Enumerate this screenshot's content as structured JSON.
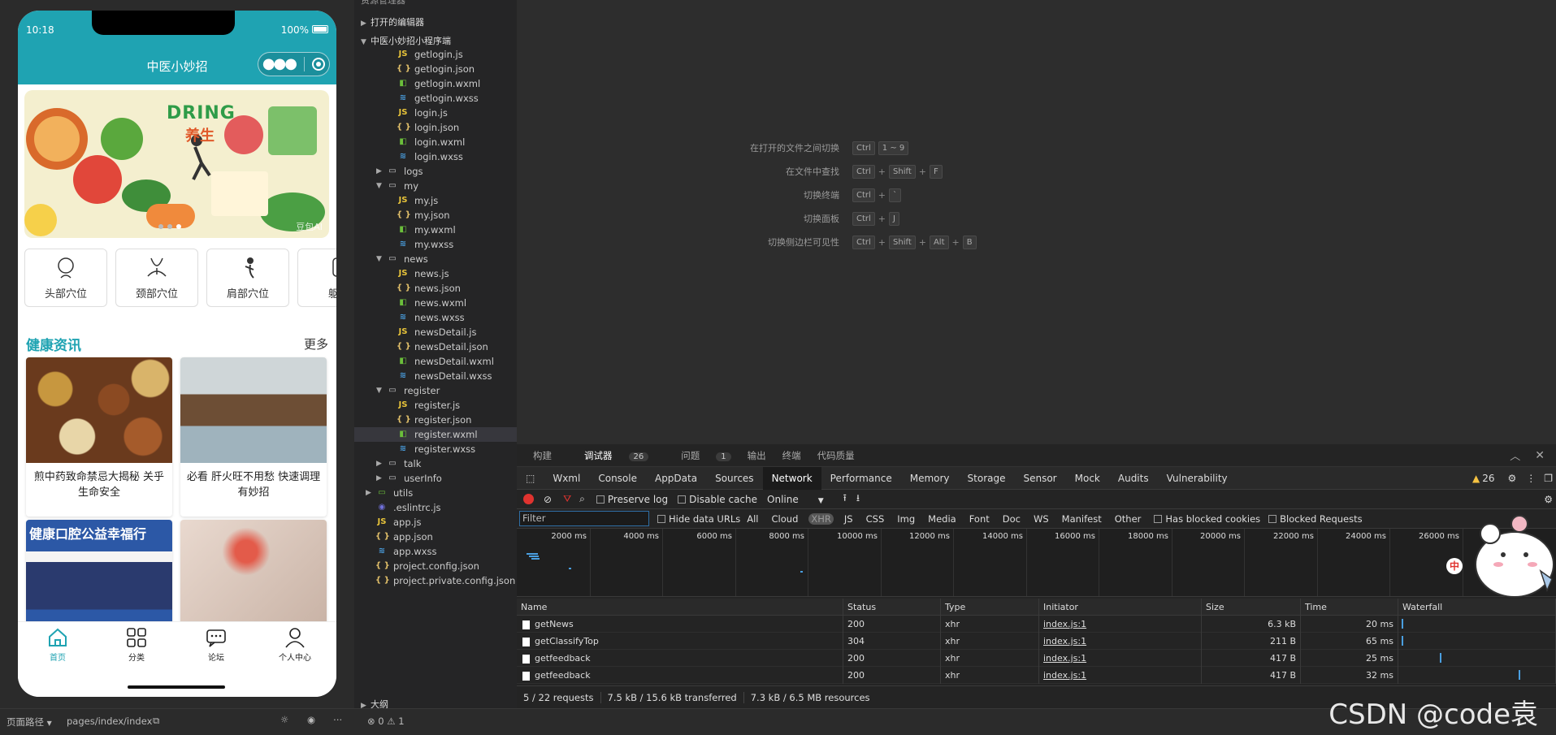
{
  "simulator": {
    "status_time": "10:18",
    "status_battery": "100%",
    "nav_title": "中医小妙招",
    "banner": {
      "text_en": "DRING",
      "text_cn": "养生",
      "watermark": "豆包AI"
    },
    "categories": [
      {
        "label": "头部穴位",
        "icon": "head-icon"
      },
      {
        "label": "颈部穴位",
        "icon": "neck-icon"
      },
      {
        "label": "肩部穴位",
        "icon": "shoulder-icon"
      },
      {
        "label": "躯干",
        "icon": "torso-icon"
      }
    ],
    "news_title": "健康资讯",
    "news_more": "更多",
    "news": [
      {
        "caption": "煎中药致命禁忌大揭秘 关乎生命安全"
      },
      {
        "caption": "必看 肝火旺不用愁 快速调理有妙招"
      },
      {
        "caption": "健康口腔公益幸福行"
      },
      {
        "caption": ""
      }
    ],
    "tabs": [
      {
        "label": "首页",
        "icon": "home-icon",
        "active": true
      },
      {
        "label": "分类",
        "icon": "grid-icon",
        "active": false
      },
      {
        "label": "论坛",
        "icon": "chat-icon",
        "active": false
      },
      {
        "label": "个人中心",
        "icon": "user-icon",
        "active": false
      }
    ]
  },
  "explorer": {
    "header": "资源管理器",
    "open_editors": "打开的编辑器",
    "project": "中医小妙招小程序端",
    "tree": [
      {
        "name": "getlogin.js",
        "type": "js",
        "depth": 2
      },
      {
        "name": "getlogin.json",
        "type": "json",
        "depth": 2
      },
      {
        "name": "getlogin.wxml",
        "type": "wxml",
        "depth": 2
      },
      {
        "name": "getlogin.wxss",
        "type": "wxss",
        "depth": 2
      },
      {
        "name": "login.js",
        "type": "js",
        "depth": 2
      },
      {
        "name": "login.json",
        "type": "json",
        "depth": 2
      },
      {
        "name": "login.wxml",
        "type": "wxml",
        "depth": 2
      },
      {
        "name": "login.wxss",
        "type": "wxss",
        "depth": 2
      },
      {
        "name": "logs",
        "type": "folder-closed",
        "depth": 1
      },
      {
        "name": "my",
        "type": "folder-open",
        "depth": 1
      },
      {
        "name": "my.js",
        "type": "js",
        "depth": 2
      },
      {
        "name": "my.json",
        "type": "json",
        "depth": 2
      },
      {
        "name": "my.wxml",
        "type": "wxml",
        "depth": 2
      },
      {
        "name": "my.wxss",
        "type": "wxss",
        "depth": 2
      },
      {
        "name": "news",
        "type": "folder-open",
        "depth": 1
      },
      {
        "name": "news.js",
        "type": "js",
        "depth": 2
      },
      {
        "name": "news.json",
        "type": "json",
        "depth": 2
      },
      {
        "name": "news.wxml",
        "type": "wxml",
        "depth": 2
      },
      {
        "name": "news.wxss",
        "type": "wxss",
        "depth": 2
      },
      {
        "name": "newsDetail.js",
        "type": "js",
        "depth": 2
      },
      {
        "name": "newsDetail.json",
        "type": "json",
        "depth": 2
      },
      {
        "name": "newsDetail.wxml",
        "type": "wxml",
        "depth": 2
      },
      {
        "name": "newsDetail.wxss",
        "type": "wxss",
        "depth": 2
      },
      {
        "name": "register",
        "type": "folder-open",
        "depth": 1
      },
      {
        "name": "register.js",
        "type": "js",
        "depth": 2
      },
      {
        "name": "register.json",
        "type": "json",
        "depth": 2
      },
      {
        "name": "register.wxml",
        "type": "wxml",
        "depth": 2,
        "selected": true
      },
      {
        "name": "register.wxss",
        "type": "wxss",
        "depth": 2
      },
      {
        "name": "talk",
        "type": "folder-closed",
        "depth": 1
      },
      {
        "name": "userInfo",
        "type": "folder-closed",
        "depth": 1
      },
      {
        "name": "utils",
        "type": "folder-closed-green",
        "depth": 0
      },
      {
        "name": ".eslintrc.js",
        "type": "eslint",
        "depth": 0
      },
      {
        "name": "app.js",
        "type": "js",
        "depth": 0
      },
      {
        "name": "app.json",
        "type": "json",
        "depth": 0
      },
      {
        "name": "app.wxss",
        "type": "wxss",
        "depth": 0
      },
      {
        "name": "project.config.json",
        "type": "json",
        "depth": 0
      },
      {
        "name": "project.private.config.json",
        "type": "json",
        "depth": 0
      }
    ],
    "outline": "大纲"
  },
  "editor": {
    "shortcuts": [
      {
        "label": "在打开的文件之间切换",
        "keys": [
          "Ctrl",
          "1 ~ 9"
        ]
      },
      {
        "label": "在文件中查找",
        "keys": [
          "Ctrl",
          "+",
          "Shift",
          "+",
          "F"
        ]
      },
      {
        "label": "切换终端",
        "keys": [
          "Ctrl",
          "+",
          "`"
        ]
      },
      {
        "label": "切换面板",
        "keys": [
          "Ctrl",
          "+",
          "J"
        ]
      },
      {
        "label": "切换侧边栏可见性",
        "keys": [
          "Ctrl",
          "+",
          "Shift",
          "+",
          "Alt",
          "+",
          "B"
        ]
      }
    ]
  },
  "devtools": {
    "panel_tabs": [
      {
        "label": "构建"
      },
      {
        "label": "调试器",
        "badge": "26",
        "active": true
      },
      {
        "label": "问题",
        "badge": "1"
      },
      {
        "label": "输出"
      },
      {
        "label": "终端"
      },
      {
        "label": "代码质量"
      }
    ],
    "tabs": [
      "Wxml",
      "Console",
      "AppData",
      "Sources",
      "Network",
      "Performance",
      "Memory",
      "Storage",
      "Sensor",
      "Mock",
      "Audits",
      "Vulnerability"
    ],
    "active_tab": "Network",
    "warnings": "26",
    "preserve_log": "Preserve log",
    "disable_cache": "Disable cache",
    "throttle": "Online",
    "filter_placeholder": "Filter",
    "hide_data_urls": "Hide data URLs",
    "filter_types": [
      "All",
      "Cloud",
      "XHR",
      "JS",
      "CSS",
      "Img",
      "Media",
      "Font",
      "Doc",
      "WS",
      "Manifest",
      "Other"
    ],
    "active_type": "XHR",
    "has_blocked_cookies": "Has blocked cookies",
    "blocked_requests": "Blocked Requests",
    "timeline_ticks": [
      "2000 ms",
      "4000 ms",
      "6000 ms",
      "8000 ms",
      "10000 ms",
      "12000 ms",
      "14000 ms",
      "16000 ms",
      "18000 ms",
      "20000 ms",
      "22000 ms",
      "24000 ms",
      "26000 ms"
    ],
    "columns": [
      "Name",
      "Status",
      "Type",
      "Initiator",
      "Size",
      "Time",
      "Waterfall"
    ],
    "rows": [
      {
        "name": "getNews",
        "status": "200",
        "type": "xhr",
        "initiator": "index.js:1",
        "size": "6.3 kB",
        "time": "20 ms"
      },
      {
        "name": "getClassifyTop",
        "status": "304",
        "type": "xhr",
        "initiator": "index.js:1",
        "size": "211 B",
        "time": "65 ms"
      },
      {
        "name": "getfeedback",
        "status": "200",
        "type": "xhr",
        "initiator": "index.js:1",
        "size": "417 B",
        "time": "25 ms"
      },
      {
        "name": "getfeedback",
        "status": "200",
        "type": "xhr",
        "initiator": "index.js:1",
        "size": "417 B",
        "time": "32 ms"
      }
    ],
    "summary": [
      "5 / 22 requests",
      "7.5 kB / 15.6 kB transferred",
      "7.3 kB / 6.5 MB resources"
    ]
  },
  "status_bar": {
    "page_path_label": "页面路径",
    "page_path": "pages/index/index",
    "errors": "0",
    "warnings": "1"
  },
  "watermark": "CSDN @code袁",
  "mascot_badge": "中"
}
